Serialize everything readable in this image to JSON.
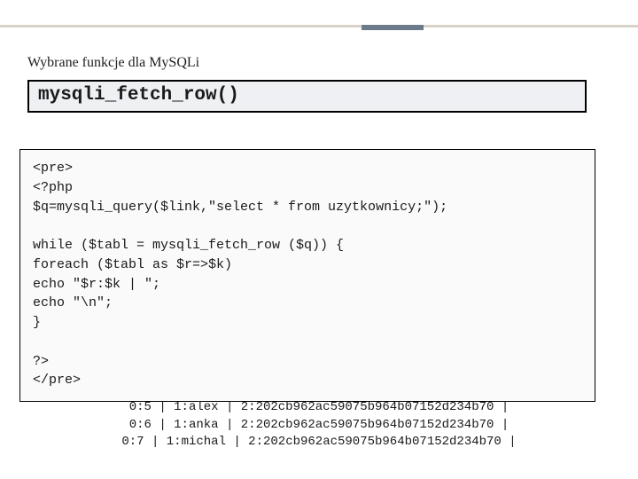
{
  "subtitle": "Wybrane funkcje dla MySQLi",
  "function_name": "mysqli_fetch_row()",
  "code": "<pre>\n<?php\n$q=mysqli_query($link,\"select * from uzytkownicy;\");\n\nwhile ($tabl = mysqli_fetch_row ($q)) {\nforeach ($tabl as $r=>$k)\necho \"$r:$k | \";\necho \"\\n\";\n}\n\n?>\n</pre>",
  "output_lines": [
    "0:5 | 1:alex | 2:202cb962ac59075b964b07152d234b70 |",
    "0:6 | 1:anka | 2:202cb962ac59075b964b07152d234b70 |",
    "0:7 | 1:michal | 2:202cb962ac59075b964b07152d234b70 |"
  ]
}
